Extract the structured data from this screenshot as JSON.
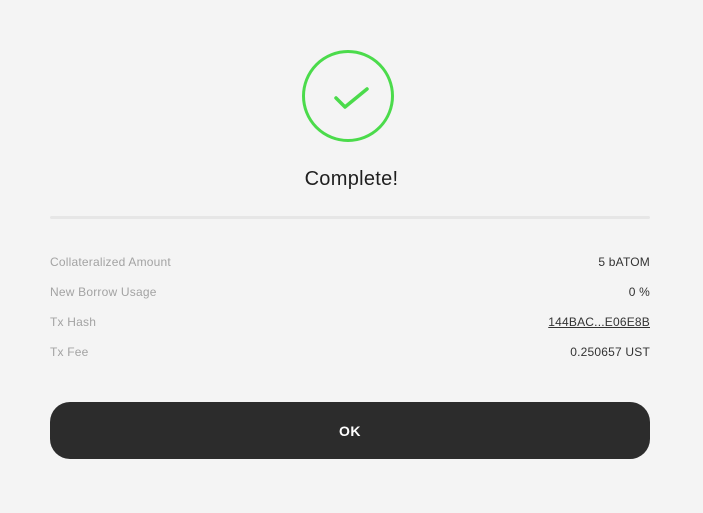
{
  "dialog": {
    "status_icon": "checkmark-circle-icon",
    "status_color": "#4bdb4b",
    "title": "Complete!",
    "details": [
      {
        "label": "Collateralized Amount",
        "value": "5 bATOM"
      },
      {
        "label": "New Borrow Usage",
        "value": "0 %"
      },
      {
        "label": "Tx Hash",
        "value": "144BAC...E06E8B"
      },
      {
        "label": "Tx Fee",
        "value": "0.250657 UST"
      }
    ],
    "ok_label": "OK"
  }
}
